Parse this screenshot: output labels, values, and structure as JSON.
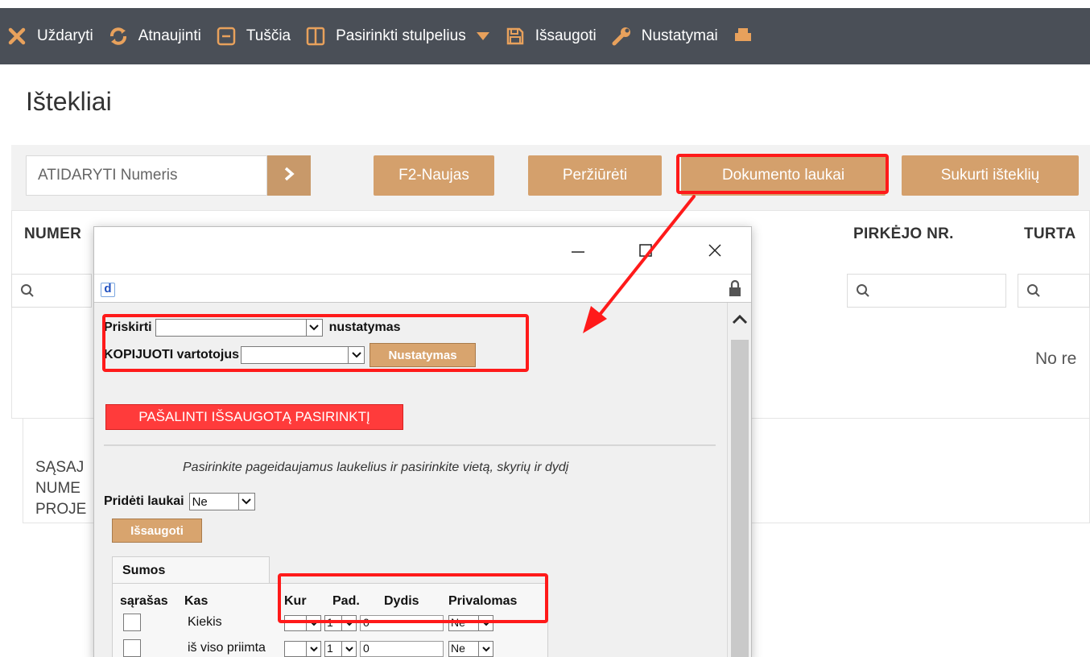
{
  "toolbar": {
    "items": [
      {
        "label": "Uždaryti",
        "icon": "close-icon"
      },
      {
        "label": "Atnaujinti",
        "icon": "refresh-icon"
      },
      {
        "label": "Tuščia",
        "icon": "empty-icon"
      },
      {
        "label": "Pasirinkti stulpelius",
        "icon": "columns-icon"
      },
      {
        "label": "Išsaugoti",
        "icon": "save-icon"
      },
      {
        "label": "Nustatymai",
        "icon": "wrench-icon"
      }
    ]
  },
  "page": {
    "title": "Ištekliai"
  },
  "actions": {
    "open_placeholder": "ATIDARYTI Numeris",
    "new_label": "F2-Naujas",
    "view_label": "Peržiūrėti",
    "doc_fields_label": "Dokumento laukai",
    "create_label": "Sukurti išteklių"
  },
  "table": {
    "headers": [
      "NUMER",
      "PIRKĖJO NR.",
      "TURTA"
    ],
    "empty_text": "No re"
  },
  "bottom_text": [
    "SĄSAJ",
    "NUME",
    "PROJE"
  ],
  "popup": {
    "assign_label": "Priskirti",
    "assign_suffix": "nustatymas",
    "copy_users_label": "KOPIJUOTI vartotojus",
    "settings_button": "Nustatymas",
    "remove_button": "PAŠALINTI IŠSAUGOTĄ PASIRINKTĮ",
    "hint": "Pasirinkite pageidaujamus laukelius ir pasirinkite vietą, skyrių ir dydį",
    "added_fields_label": "Pridėti laukai",
    "added_fields_value": "Ne",
    "save_button": "Išsaugoti",
    "tab_label": "Sumos",
    "columns": {
      "list": "sąrašas",
      "what": "Kas",
      "where": "Kur",
      "pos": "Pad.",
      "size": "Dydis",
      "required": "Privalomas"
    },
    "rows": [
      {
        "name": "Kiekis",
        "pos": "1",
        "size": "0",
        "required": "Ne"
      },
      {
        "name": "iš viso priimta",
        "pos": "1",
        "size": "0",
        "required": "Ne"
      }
    ]
  },
  "colors": {
    "toolbar_bg": "#4a4f57",
    "button_tan": "#d4a06c",
    "highlight_red": "#ff1a1a",
    "danger_red": "#ff3b3b"
  }
}
